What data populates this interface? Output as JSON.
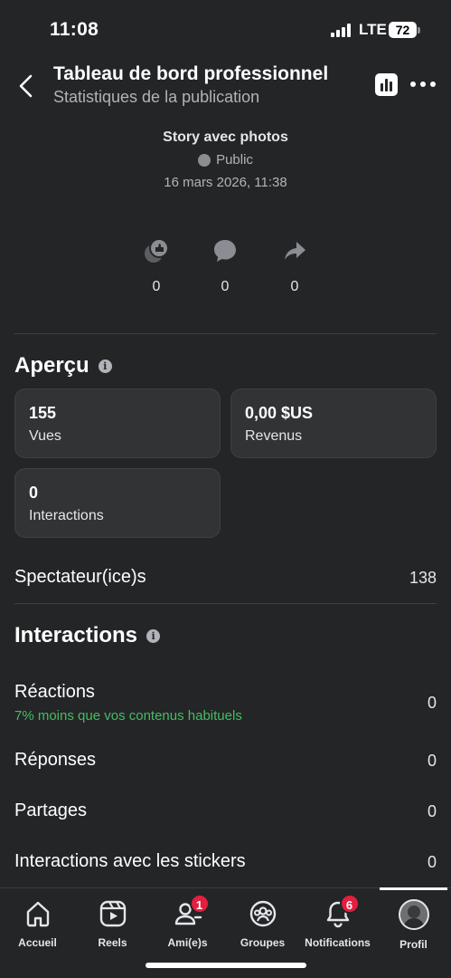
{
  "status_bar": {
    "time": "11:08",
    "network": "LTE",
    "battery": "72"
  },
  "header": {
    "title": "Tableau de bord professionnel",
    "subtitle": "Statistiques de la publication",
    "icons": [
      "back-arrow-icon",
      "bar-chart-icon",
      "more-icon"
    ]
  },
  "post": {
    "title": "Story avec photos",
    "privacy": "Public",
    "date": "16 mars 2026, 11:38"
  },
  "stats": {
    "reactions": "0",
    "comments": "0",
    "shares": "0"
  },
  "overview": {
    "heading": "Aperçu",
    "cards": {
      "views": {
        "value": "155",
        "label": "Vues"
      },
      "revenue": {
        "value": "0,00 $US",
        "label": "Revenus"
      },
      "interactions": {
        "value": "0",
        "label": "Interactions"
      }
    },
    "viewers": {
      "label": "Spectateur(ice)s",
      "value": "138"
    }
  },
  "interactions": {
    "heading": "Interactions",
    "rows": [
      {
        "label": "Réactions",
        "value": "0",
        "note": "7% moins que vos contenus habituels"
      },
      {
        "label": "Réponses",
        "value": "0"
      },
      {
        "label": "Partages",
        "value": "0"
      },
      {
        "label": "Interactions avec les stickers",
        "value": "0"
      }
    ]
  },
  "nav": {
    "items": [
      {
        "label": "Accueil",
        "icon": "home-icon"
      },
      {
        "label": "Reels",
        "icon": "reels-icon"
      },
      {
        "label": "Ami(e)s",
        "icon": "friends-icon",
        "badge": "1"
      },
      {
        "label": "Groupes",
        "icon": "groups-icon"
      },
      {
        "label": "Notifications",
        "icon": "bell-icon",
        "badge": "6"
      },
      {
        "label": "Profil",
        "icon": "avatar"
      }
    ],
    "active": "Profil"
  },
  "colors": {
    "background": "#242527",
    "card": "#323335",
    "positive": "#45bd62",
    "badge": "#e41e3f"
  }
}
